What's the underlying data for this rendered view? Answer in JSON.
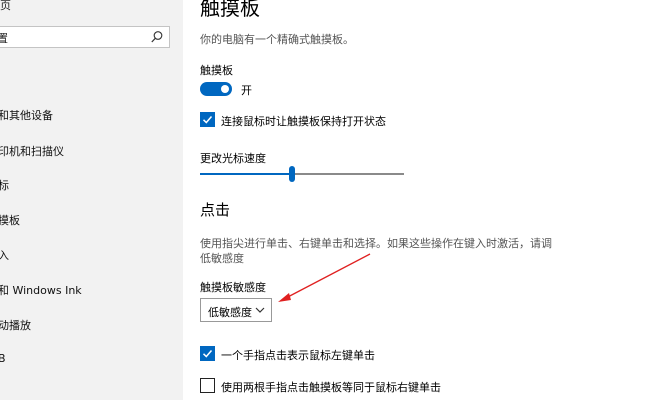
{
  "sidebar": {
    "top_text": "页",
    "search": {
      "value": "置"
    },
    "items": [
      {
        "label": "和其他设备"
      },
      {
        "label": "印机和扫描仪"
      },
      {
        "label": "标"
      },
      {
        "label": "摸板"
      },
      {
        "label": "入"
      },
      {
        "label": "和 Windows Ink"
      },
      {
        "label": "动播放"
      },
      {
        "label": "B"
      }
    ]
  },
  "main": {
    "title": "触摸板",
    "description": "你的电脑有一个精确式触摸板。",
    "touchpad_label": "触摸板",
    "toggle_state_label": "开",
    "keep_on_mouse_label": "连接鼠标时让触摸板保持打开状态",
    "cursor_speed_label": "更改光标速度",
    "cursor_speed_level": 0.45,
    "taps_heading": "点击",
    "taps_description_line1": "使用指尖进行单击、右键单击和选择。如果这些操作在键入时激活，请调",
    "taps_description_line2": "低敏感度",
    "sensitivity_label": "触摸板敏感度",
    "sensitivity_value": "低敏感度",
    "tap_single_label": "一个手指点击表示鼠标左键单击",
    "tap_single_checked": true,
    "tap_two_label": "使用两根手指点击触摸板等同于鼠标右键单击",
    "tap_two_checked": false
  },
  "colors": {
    "accent": "#0067c0",
    "annotation_arrow": "#e02020"
  }
}
